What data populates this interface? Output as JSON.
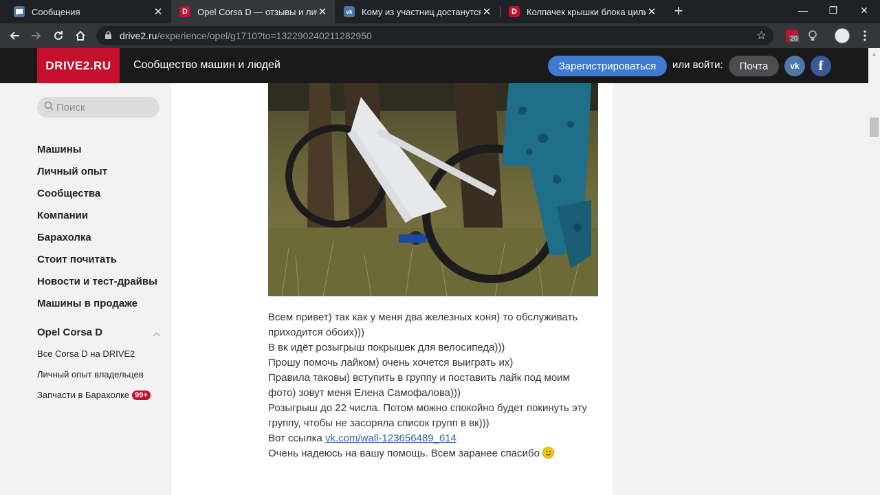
{
  "browser": {
    "tabs": [
      {
        "title": "Сообщения",
        "favicon": "messages-favicon-icon",
        "active": false
      },
      {
        "title": "Opel Corsa D — отзывы и личный опыт",
        "favicon": "drive2-favicon-icon",
        "active": true
      },
      {
        "title": "Кому из участниц достанутся по...",
        "favicon": "vk-favicon-icon",
        "active": false
      },
      {
        "title": "Колпачек крышки блока цилиндр...",
        "favicon": "drive2-favicon-icon",
        "active": false
      }
    ],
    "url_host": "drive2.ru",
    "url_path": "/experience/opel/g1710?to=132290240211282950",
    "extension_badge": "20",
    "close_glyph": "✕",
    "newtab_glyph": "+",
    "window_controls": {
      "minimize": "—",
      "restore": "❐",
      "close": "✕"
    }
  },
  "header": {
    "logo": "DRIVE2.RU",
    "tagline": "Сообщество машин и людей",
    "register_label": "Зарегистрироваться",
    "login_label": "или войти:",
    "mail_label": "Почта",
    "vk_label": "vk",
    "fb_label": "f"
  },
  "sidebar": {
    "search_placeholder": "Поиск",
    "nav": [
      "Машины",
      "Личный опыт",
      "Сообщества",
      "Компании",
      "Барахолка",
      "Стоит почитать",
      "Новости и тест-драйвы",
      "Машины в продаже"
    ],
    "group_title": "Opel Corsa D",
    "sub_items": [
      {
        "label": "Все Corsa D на DRIVE2"
      },
      {
        "label": "Личный опыт владельцев"
      },
      {
        "label": "Запчасти в Барахолке",
        "badge": "99+"
      }
    ]
  },
  "post": {
    "paragraphs": [
      "Всем привет) так как у меня два железных коня) то обслуживать приходится обоих)))",
      "В вк идёт розыгрыш покрышек для велосипеда)))",
      "Прошу помочь лайком) очень хочется выиграть их)",
      "Правила таковы) вступить в группу и поставить лайк под моим фото) зовут меня Елена Самофалова)))",
      "Розыгрыш до 22 числа. Потом можно спокойно будет покинуть эту группу, чтобы не засоряла список групп в вк)))"
    ],
    "link_prefix": "Вот ссылка ",
    "link_text": "vk.com/wall-123656489_614",
    "closing": "Очень надеюсь на вашу помощь. Всем заранее спасибо ",
    "closing_emoji": "smile-emoji-icon"
  },
  "colors": {
    "brand_red": "#c4102c",
    "register_blue": "#3e7bd1",
    "link_blue": "#2f62a8",
    "header_bg": "#1a1a1a"
  }
}
